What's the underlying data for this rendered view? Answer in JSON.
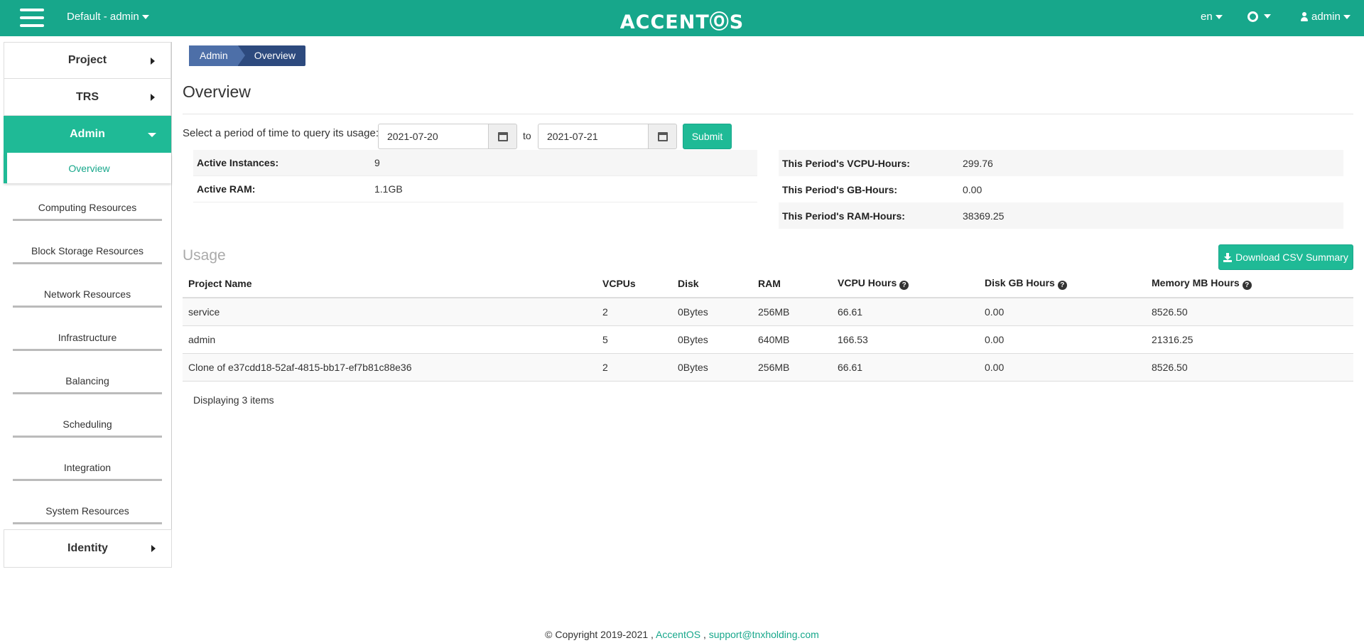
{
  "header": {
    "project_select": "Default - admin",
    "logo": "ACCENTⓄS",
    "language": "en",
    "user": "admin"
  },
  "sidebar": {
    "project": "Project",
    "trs": "TRS",
    "admin": "Admin",
    "admin_items": [
      "Overview",
      "Computing Resources",
      "Block Storage Resources",
      "Network Resources",
      "Infrastructure",
      "Balancing",
      "Scheduling",
      "Integration",
      "System Resources"
    ],
    "identity": "Identity"
  },
  "breadcrumb": {
    "parent": "Admin",
    "current": "Overview"
  },
  "page_title": "Overview",
  "query": {
    "label": "Select a period of time to query its usage:",
    "start": "2021-07-20",
    "to_label": "to",
    "end": "2021-07-21",
    "submit": "Submit"
  },
  "stats_left": [
    {
      "label": "Active Instances:",
      "value": "9"
    },
    {
      "label": "Active RAM:",
      "value": "1.1GB"
    }
  ],
  "stats_right": [
    {
      "label": "This Period's VCPU-Hours:",
      "value": "299.76"
    },
    {
      "label": "This Period's GB-Hours:",
      "value": "0.00"
    },
    {
      "label": "This Period's RAM-Hours:",
      "value": "38369.25"
    }
  ],
  "usage": {
    "title": "Usage",
    "csv_button": "Download CSV Summary",
    "columns": [
      "Project Name",
      "VCPUs",
      "Disk",
      "RAM",
      "VCPU Hours",
      "Disk GB Hours",
      "Memory MB Hours"
    ],
    "rows": [
      [
        "service",
        "2",
        "0Bytes",
        "256MB",
        "66.61",
        "0.00",
        "8526.50"
      ],
      [
        "admin",
        "5",
        "0Bytes",
        "640MB",
        "166.53",
        "0.00",
        "21316.25"
      ],
      [
        "Clone of e37cdd18-52af-4815-bb17-ef7b81c88e36",
        "2",
        "0Bytes",
        "256MB",
        "66.61",
        "0.00",
        "8526.50"
      ]
    ],
    "displaying": "Displaying 3 items"
  },
  "footer": {
    "copyright": "© Copyright 2019-2021 ,",
    "brand": "AccentOS",
    "sep": ",",
    "email": "support@tnxholding.com"
  }
}
